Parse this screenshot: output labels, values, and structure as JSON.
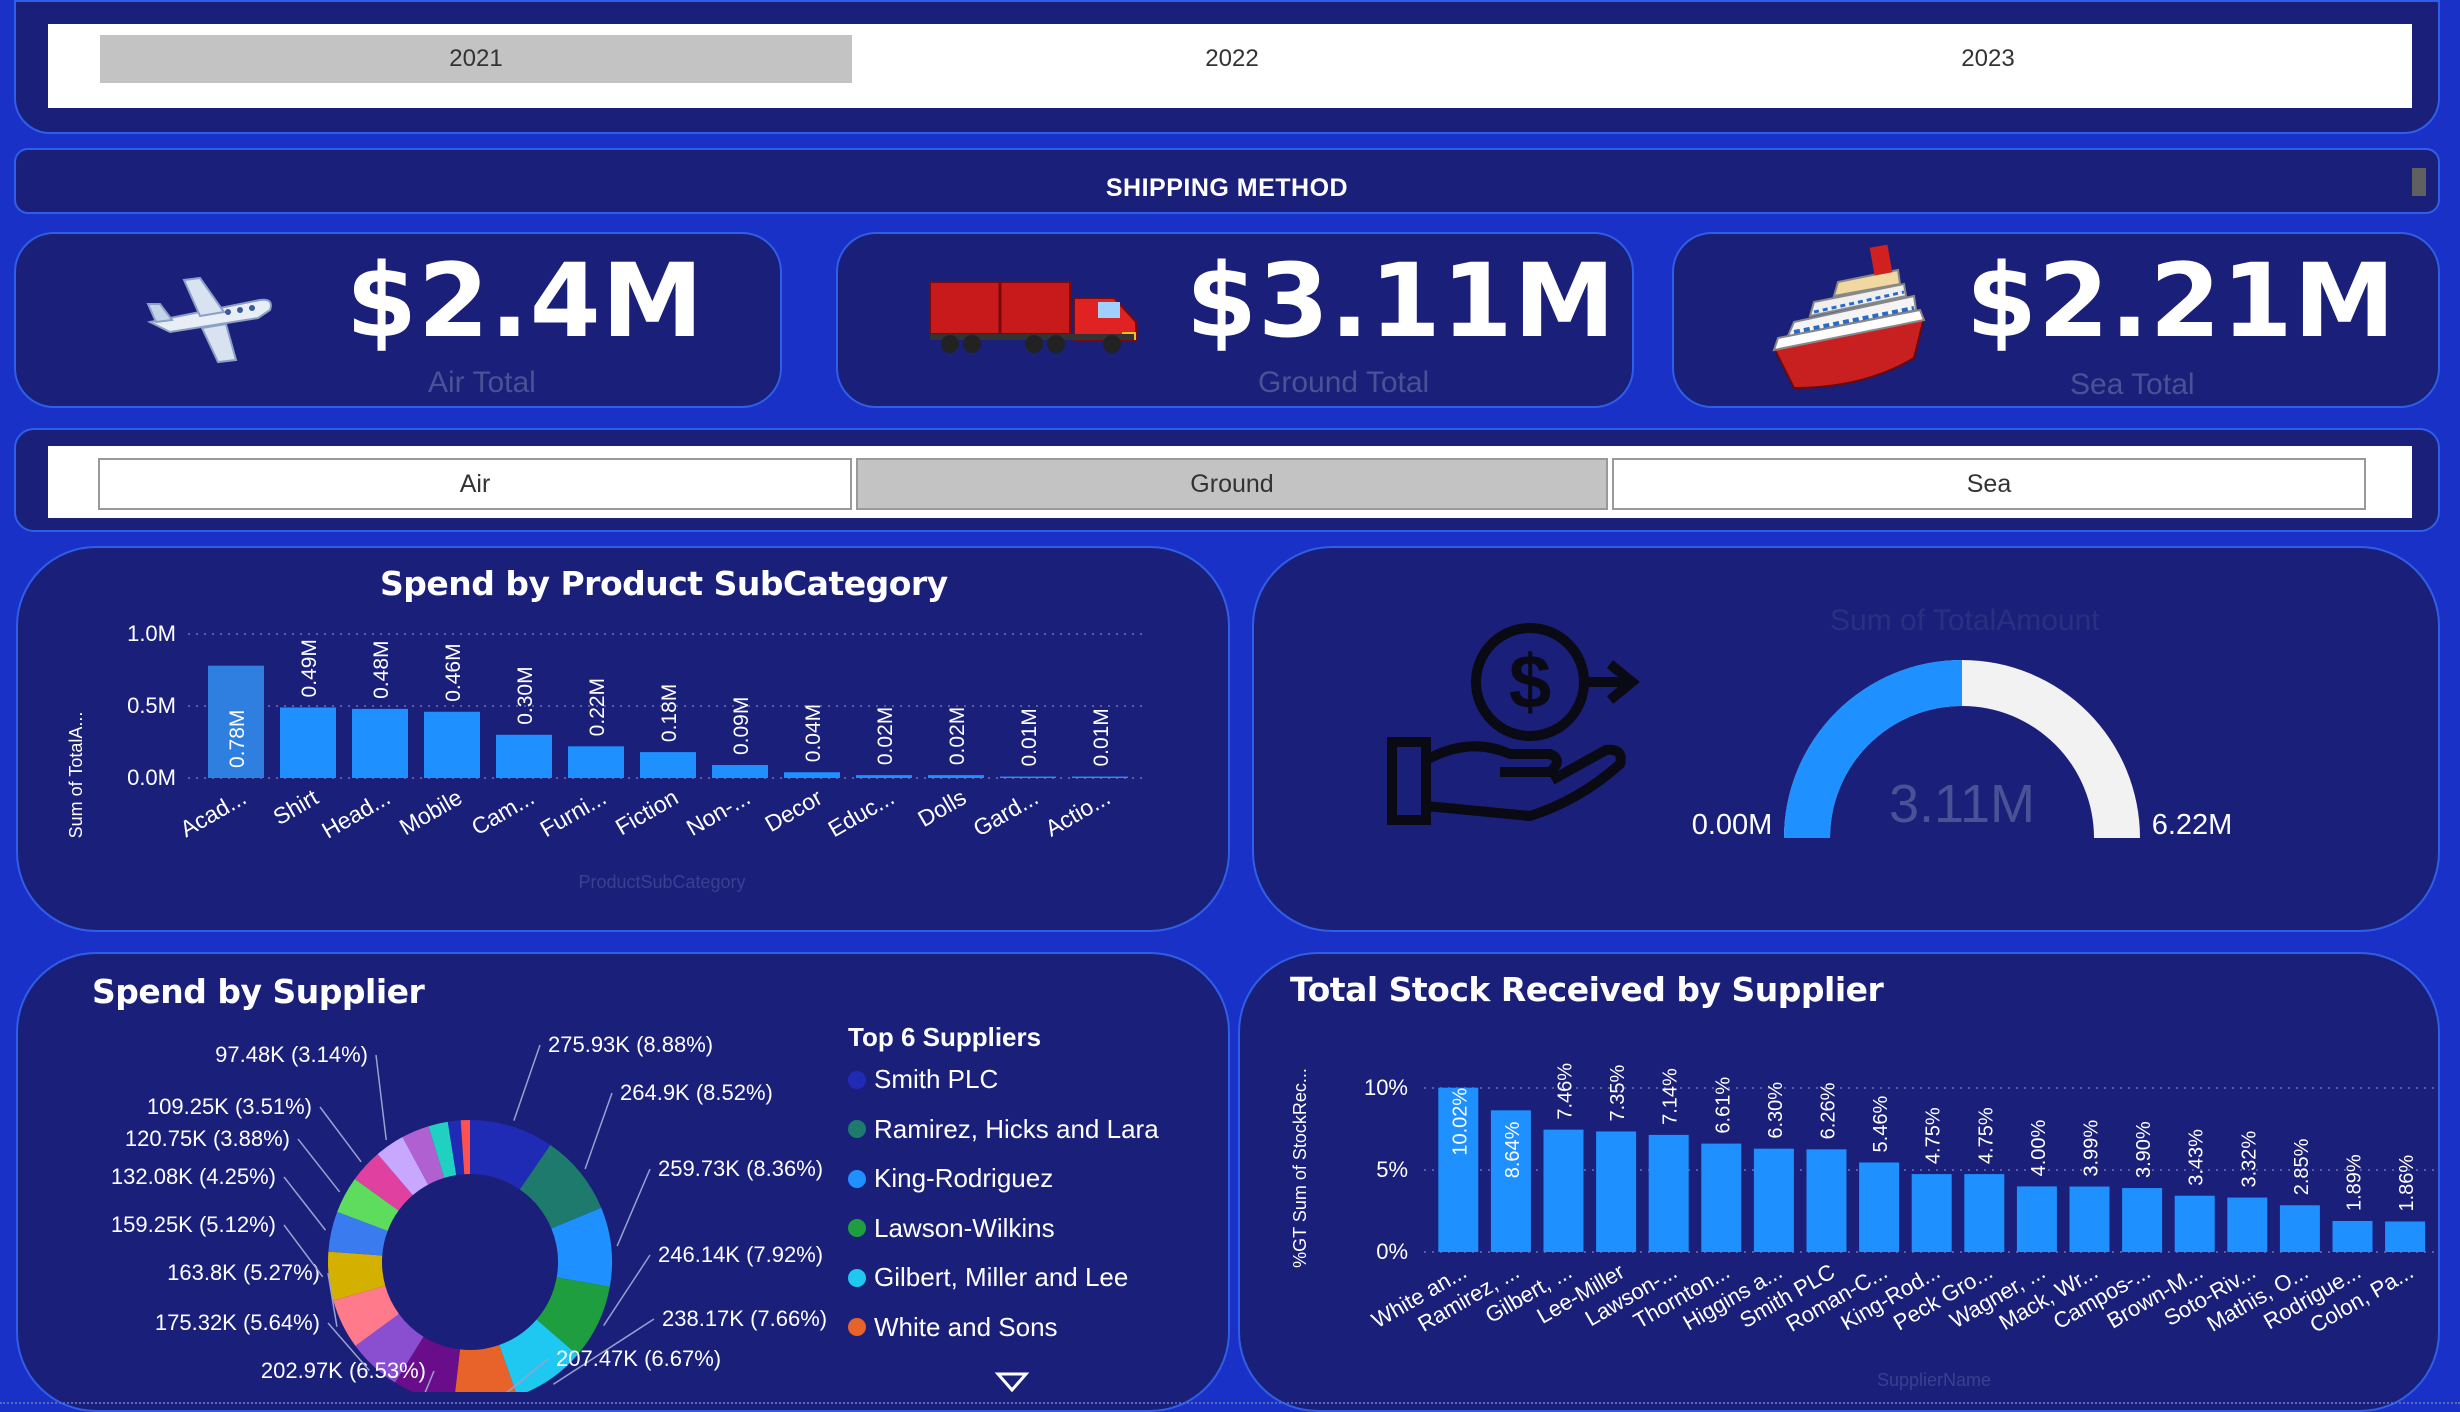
{
  "year_slicer": {
    "items": [
      "2021",
      "2022",
      "2023"
    ],
    "selected": "2021"
  },
  "shipping_header": {
    "title": "SHIPPING METHOD"
  },
  "kpis": [
    {
      "value": "$2.4M",
      "label": "Air Total",
      "icon": "airplane-icon"
    },
    {
      "value": "$3.11M",
      "label": "Ground Total",
      "icon": "truck-icon"
    },
    {
      "value": "$2.21M",
      "label": "Sea Total",
      "icon": "ship-icon"
    }
  ],
  "mode_slicer": {
    "items": [
      "Air",
      "Ground",
      "Sea"
    ],
    "selected": "Ground"
  },
  "subcategory_chart": {
    "title": "Spend by Product SubCategory",
    "ylabel": "Sum of TotalA...",
    "xlabel": "ProductSubCategory",
    "y_ticks": [
      "1.0M",
      "0.5M",
      "0.0M"
    ]
  },
  "gauge_card": {
    "title": "Sum of TotalAmount",
    "value": "3.11M",
    "min": "0.00M",
    "max": "6.22M",
    "icon": "money-hand-icon"
  },
  "supplier_donut": {
    "title": "Spend by Supplier",
    "legend_title": "Top 6 Suppliers",
    "legend_items": [
      "Smith PLC",
      "Ramirez, Hicks and Lara",
      "King-Rodriguez",
      "Lawson-Wilkins",
      "Gilbert, Miller and Lee",
      "White and Sons"
    ],
    "legend_colors": [
      "#1f2bb5",
      "#1f7a6e",
      "#1e90ff",
      "#1e9e3e",
      "#1ec8f0",
      "#e8632a"
    ]
  },
  "stock_chart": {
    "title": "Total Stock Received by Supplier",
    "ylabel": "%GT Sum of StockRec...",
    "xlabel": "SupplierName",
    "y_ticks": [
      "10%",
      "5%",
      "0%"
    ]
  },
  "colors": {
    "bar": "#1e90ff",
    "bar_selected": "#2f7fe0",
    "panel": "#1a1f7a",
    "background": "#1a31c7"
  },
  "chart_data": [
    {
      "type": "bar",
      "title": "Spend by Product SubCategory",
      "xlabel": "ProductSubCategory",
      "ylabel": "Sum of TotalA...",
      "ylim": [
        0,
        1.0
      ],
      "categories": [
        "Acad...",
        "Shirt",
        "Head...",
        "Mobile",
        "Cam...",
        "Furni...",
        "Fiction",
        "Non-...",
        "Decor",
        "Educ...",
        "Dolls",
        "Gard...",
        "Actio..."
      ],
      "values": [
        0.78,
        0.49,
        0.48,
        0.46,
        0.3,
        0.22,
        0.18,
        0.09,
        0.04,
        0.02,
        0.02,
        0.01,
        0.01
      ],
      "labels": [
        "0.78M",
        "0.49M",
        "0.48M",
        "0.46M",
        "0.30M",
        "0.22M",
        "0.18M",
        "0.09M",
        "0.04M",
        "0.02M",
        "0.02M",
        "0.01M",
        "0.01M"
      ]
    },
    {
      "type": "pie",
      "title": "Spend by Supplier",
      "values": [
        275.93,
        264.9,
        259.73,
        246.14,
        238.17,
        207.47,
        202.97,
        175.32,
        163.8,
        159.25,
        132.08,
        120.75,
        109.25,
        97.48
      ],
      "labels": [
        "275.93K (8.88%)",
        "264.9K (8.52%)",
        "259.73K (8.36%)",
        "246.14K (7.92%)",
        "238.17K (7.66%)",
        "207.47K (6.67%)",
        "202.97K (6.53%)",
        "175.32K (5.64%)",
        "163.8K (5.27%)",
        "159.25K (5.12%)",
        "132.08K (4.25%)",
        "120.75K (3.88%)",
        "109.25K (3.51%)",
        "97.48K (3.14%)"
      ],
      "colors": [
        "#1f2bb5",
        "#1f7a6e",
        "#1e90ff",
        "#1e9e3e",
        "#1ec8f0",
        "#e8632a",
        "#6a0d8a",
        "#8a4fd0",
        "#ff7a8a",
        "#d4b000",
        "#3a7cf0",
        "#5ddc5d",
        "#e040a0",
        "#c8a8ff",
        "#b060d0",
        "#20d0c0",
        "#1f2bb5",
        "#ff5050"
      ]
    },
    {
      "type": "bar",
      "title": "Total Stock Received by Supplier",
      "xlabel": "SupplierName",
      "ylabel": "%GT Sum of StockRec...",
      "ylim": [
        0,
        10
      ],
      "categories": [
        "White an...",
        "Ramirez, ...",
        "Gilbert, ...",
        "Lee-Miller",
        "Lawson-...",
        "Thornton...",
        "Higgins a...",
        "Smith PLC",
        "Roman-C...",
        "King-Rod...",
        "Peck Gro...",
        "Wagner, ...",
        "Mack, Wr...",
        "Campos-...",
        "Brown-M...",
        "Soto-Riv...",
        "Mathis, O...",
        "Rodrigue...",
        "Colon, Pa..."
      ],
      "values": [
        10.02,
        8.64,
        7.46,
        7.35,
        7.14,
        6.61,
        6.3,
        6.26,
        5.46,
        4.75,
        4.75,
        4.0,
        3.99,
        3.9,
        3.43,
        3.32,
        2.85,
        1.89,
        1.86
      ],
      "labels": [
        "10.02%",
        "8.64%",
        "7.46%",
        "7.35%",
        "7.14%",
        "6.61%",
        "6.30%",
        "6.26%",
        "5.46%",
        "4.75%",
        "4.75%",
        "4.00%",
        "3.99%",
        "3.90%",
        "3.43%",
        "3.32%",
        "2.85%",
        "1.89%",
        "1.86%"
      ]
    }
  ]
}
